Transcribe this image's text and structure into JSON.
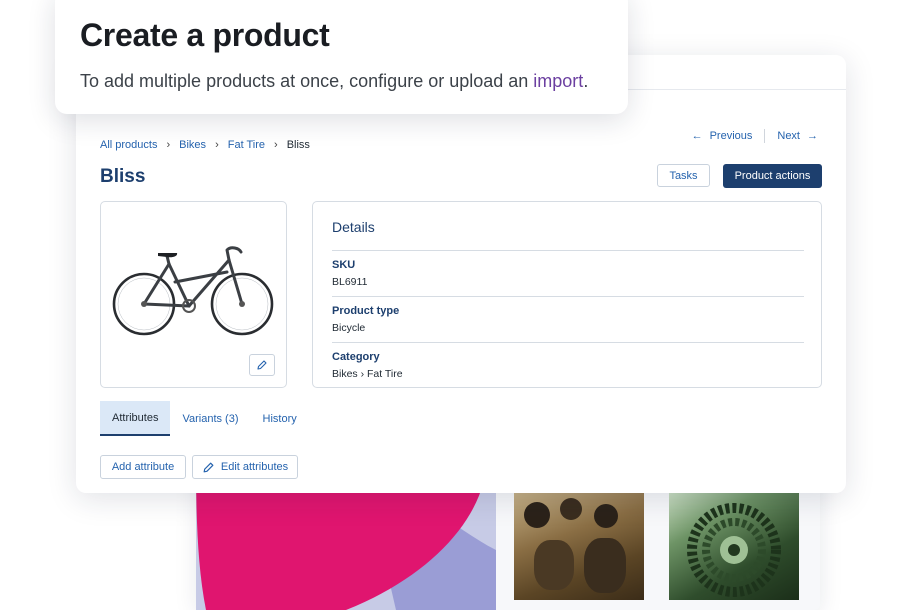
{
  "heading": {
    "title": "Create a product",
    "description": "To add multiple products at once, configure or upload an ",
    "import_link": "import",
    "period": "."
  },
  "breadcrumb": {
    "items": [
      "All products",
      "Bikes",
      "Fat Tire"
    ],
    "current": "Bliss"
  },
  "pager": {
    "previous": "Previous",
    "next": "Next"
  },
  "product": {
    "title": "Bliss"
  },
  "header_actions": {
    "tasks": "Tasks",
    "product_actions": "Product actions"
  },
  "details": {
    "title": "Details",
    "fields": [
      {
        "label": "SKU",
        "value": "BL6911"
      },
      {
        "label": "Product type",
        "value": "Bicycle"
      },
      {
        "label": "Category",
        "value": "Bikes › Fat Tire"
      }
    ]
  },
  "tabs": [
    {
      "label": "Attributes",
      "active": true
    },
    {
      "label": "Variants (3)",
      "active": false
    },
    {
      "label": "History",
      "active": false
    }
  ],
  "attribute_actions": {
    "add": "Add attribute",
    "edit": "Edit attributes"
  },
  "colors": {
    "brand_navy": "#1d3f6e",
    "link_blue": "#2563ae",
    "import_purple": "#6b3fa0",
    "accent_magenta": "#e0156f"
  },
  "icons": [
    "arrow-left-icon",
    "arrow-right-icon",
    "pencil-icon",
    "chevron-right-icon"
  ]
}
